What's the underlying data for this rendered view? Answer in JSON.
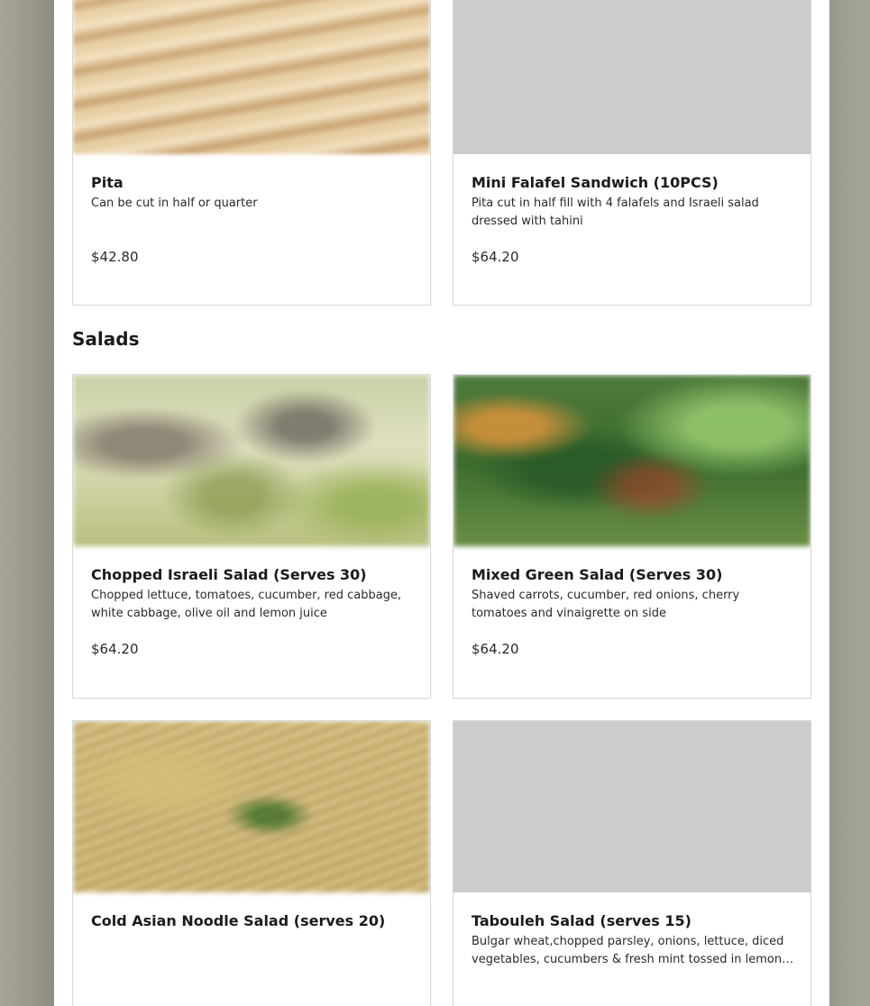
{
  "sections": [
    {
      "name": "",
      "items": [
        {
          "title": "Pita",
          "description": "Can be cut in half or quarter",
          "price": "$42.80",
          "image": "pita-photo"
        },
        {
          "title": "Mini Falafel Sandwich (10PCS)",
          "description": "Pita cut in half fill with 4 falafels and Israeli salad dressed with tahini",
          "price": "$64.20",
          "image": "placeholder"
        }
      ]
    },
    {
      "name": "Salads",
      "items": [
        {
          "title": "Chopped Israeli Salad (Serves 30)",
          "description": "Chopped lettuce, tomatoes, cucumber, red cabbage, white cabbage, olive oil and lemon juice",
          "price": "$64.20",
          "image": "israeli-salad-photo"
        },
        {
          "title": "Mixed Green Salad (Serves 30)",
          "description": "Shaved carrots, cucumber, red onions, cherry tomatoes and vinaigrette on side",
          "price": "$64.20",
          "image": "mixed-green-salad-photo"
        },
        {
          "title": "Cold Asian Noodle Salad (serves 20)",
          "description": "",
          "price": "",
          "image": "noodle-salad-photo"
        },
        {
          "title": "Tabouleh Salad (serves 15)",
          "description": "Bulgar wheat,chopped parsley, onions, lettuce, diced vegetables, cucumbers & fresh mint tossed in lemon juice",
          "price": "",
          "image": "placeholder"
        }
      ]
    }
  ]
}
